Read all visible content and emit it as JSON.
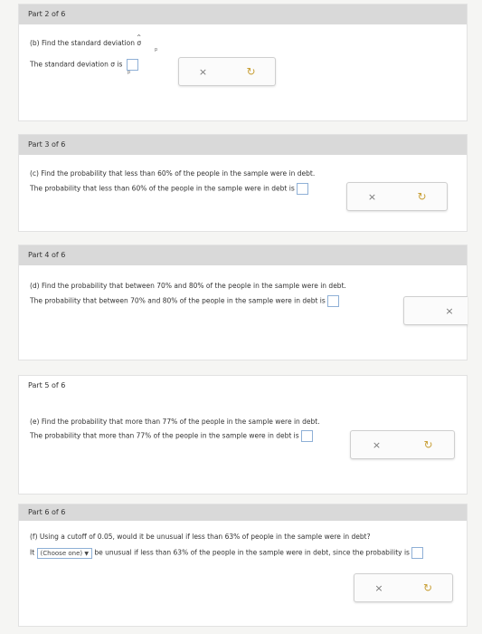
{
  "part2": {
    "header": "Part 2 of 6",
    "question": "(b) Find the standard deviation σ",
    "answer_prefix": "The standard deviation σ",
    "answer_mid": " is ",
    "hat": "^",
    "sub": "p",
    "clear_icon": "×",
    "redo_icon": "↻"
  },
  "part3": {
    "header": "Part 3 of 6",
    "question": "(c) Find the probability that less than 60% of the people in the sample were in debt.",
    "answer": "The probability that less than 60% of the people in the sample were in debt is",
    "clear_icon": "×",
    "redo_icon": "↻"
  },
  "part4": {
    "header": "Part 4 of 6",
    "question": "(d) Find the probability that between 70% and 80% of the people in the sample were in debt.",
    "answer": "The probability that between 70% and 80% of the people in the sample were in debt is",
    "clear_icon": "×"
  },
  "part5": {
    "header": "Part 5 of 6",
    "question": "(e) Find the probability that more than 77% of the people in the sample were in debt.",
    "answer": "The probability that more than 77% of the people in the sample were in debt is",
    "clear_icon": "×",
    "redo_icon": "↻"
  },
  "part6": {
    "header": "Part 6 of 6",
    "question": "(f) Using a cutoff of 0.05, would it be unusual if less than 63% of people in the sample were in debt?",
    "answer_prefix": "It",
    "select_label": "(Choose one)",
    "select_arrow": "▼",
    "answer_rest": "be unusual if less than 63% of the people in the sample were in debt, since the probability is",
    "clear_icon": "×",
    "redo_icon": "↻"
  }
}
